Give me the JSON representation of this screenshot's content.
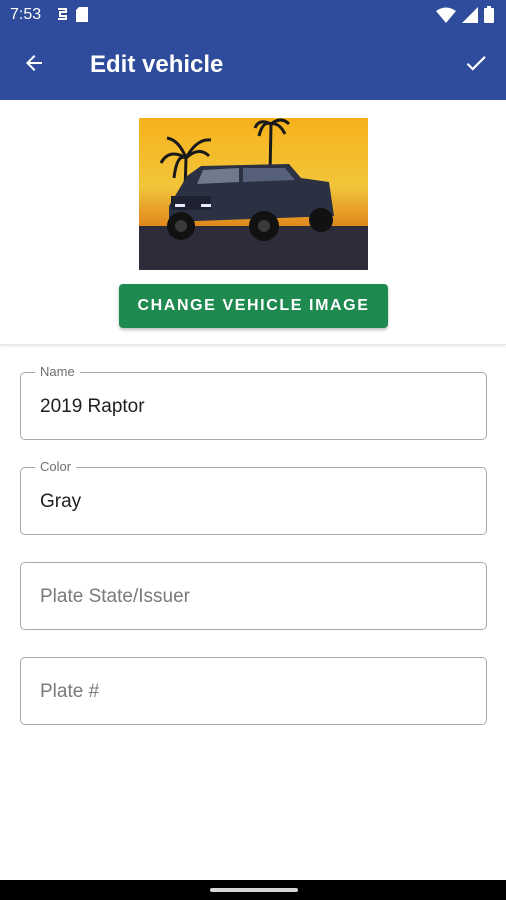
{
  "status_bar": {
    "time": "7:53",
    "icons_left": [
      "sync-icon",
      "sd-card-icon"
    ],
    "icons_right": [
      "wifi-icon",
      "signal-icon",
      "battery-icon"
    ]
  },
  "app_bar": {
    "title": "Edit vehicle",
    "back_icon": "arrow-back-icon",
    "save_icon": "check-icon",
    "background_color": "#2f4b9b"
  },
  "vehicle_image": {
    "button_label": "CHANGE VEHICLE IMAGE",
    "button_color": "#1e8a50"
  },
  "form": {
    "name": {
      "label": "Name",
      "value": "2019 Raptor"
    },
    "color": {
      "label": "Color",
      "value": "Gray"
    },
    "plate_state": {
      "placeholder": "Plate State/Issuer"
    },
    "plate_number": {
      "placeholder": "Plate #"
    }
  }
}
